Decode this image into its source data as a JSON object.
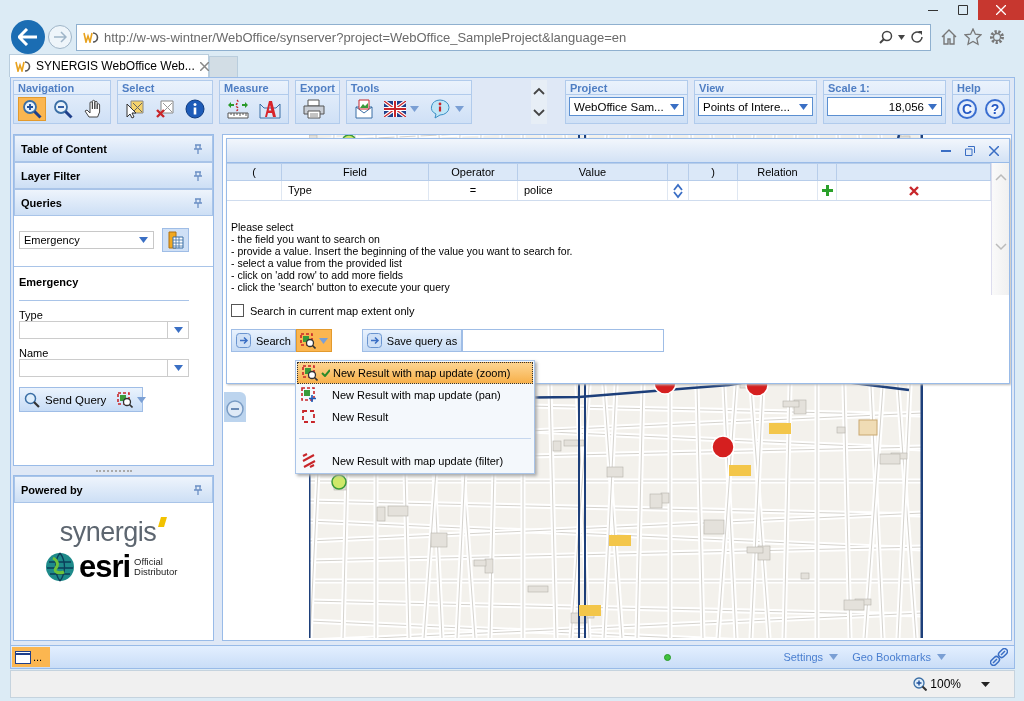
{
  "browser": {
    "url": "http://w-ws-wintner/WebOffice/synserver?project=WebOffice_SampleProject&language=en",
    "tabs": [
      {
        "title": "SYNERGIS WebOffice Web...",
        "selected": true
      }
    ]
  },
  "toolbar": {
    "groups": [
      {
        "title": "Navigation",
        "tools": [
          {
            "kind": "zoom-in",
            "selected": true
          },
          {
            "kind": "zoom-out",
            "selected": false
          },
          {
            "kind": "pan",
            "selected": false
          }
        ]
      },
      {
        "title": "Select",
        "tools": [
          {
            "kind": "select",
            "selected": false
          },
          {
            "kind": "clear-selection",
            "selected": false
          },
          {
            "kind": "info",
            "selected": false
          }
        ]
      },
      {
        "title": "Measure",
        "tools": [
          {
            "kind": "measure",
            "selected": false
          },
          {
            "kind": "annotate",
            "selected": false
          }
        ]
      },
      {
        "title": "Export",
        "tools": [
          {
            "kind": "print",
            "selected": false
          }
        ]
      },
      {
        "title": "Tools",
        "tools": [
          {
            "kind": "map-image",
            "selected": false
          },
          {
            "kind": "flag",
            "selected": false,
            "dropdown": true
          },
          {
            "kind": "tooltip",
            "selected": false,
            "dropdown": true
          }
        ]
      }
    ],
    "selectors": [
      {
        "title": "Project",
        "value": "WebOffice Sam...",
        "kind": "text"
      },
      {
        "title": "View",
        "value": "Points of Intere...",
        "kind": "text"
      },
      {
        "title": "Scale 1:",
        "value": "18,056",
        "kind": "number"
      }
    ],
    "help": {
      "title": "Help",
      "buttons": [
        "C",
        "?"
      ]
    }
  },
  "sidebar": {
    "panels": [
      {
        "title": "Table of Content",
        "expanded": false
      },
      {
        "title": "Layer Filter",
        "expanded": false
      },
      {
        "title": "Queries",
        "expanded": true
      }
    ],
    "query_select": "Emergency",
    "query_title": "Emergency",
    "fields": [
      {
        "label": "Type"
      },
      {
        "label": "Name"
      }
    ],
    "send_button": "Send Query",
    "powered_by": {
      "title": "Powered by",
      "synergis": "synergis",
      "esri": "esri",
      "esri_note": "Official Distributor"
    }
  },
  "query_window": {
    "columns": [
      {
        "kind": "open",
        "label": "("
      },
      {
        "kind": "field",
        "label": "Field"
      },
      {
        "kind": "operator",
        "label": "Operator"
      },
      {
        "kind": "value",
        "label": "Value"
      },
      {
        "kind": "spin"
      },
      {
        "kind": "close",
        "label": ")"
      },
      {
        "kind": "relation",
        "label": "Relation"
      },
      {
        "kind": "add"
      },
      {
        "kind": "remove"
      }
    ],
    "rows": [
      {
        "field": "Type",
        "operator": "=",
        "value": "police"
      }
    ],
    "instructions": [
      "Please select",
      "- the field you want to search on",
      "- provide a value. Insert the beginning of the value you want to search for.",
      "- select a value from the provided list",
      "- click on 'add row' to add more fields",
      "- click the 'search' button to execute your query"
    ],
    "extent_checkbox": {
      "label": "Search in current map extent only",
      "checked": false
    },
    "search_button": "Search",
    "save_button": "Save query as",
    "result_menu": [
      {
        "kind": "zoom",
        "label": "New Result with map update (zoom)",
        "selected": true,
        "divider_before": false
      },
      {
        "kind": "pan",
        "label": "New Result with map update (pan)",
        "selected": false,
        "divider_before": false
      },
      {
        "kind": "new",
        "label": "New Result",
        "selected": false,
        "divider_before": false
      },
      {
        "kind": "filter",
        "label": "New Result with map update (filter)",
        "selected": false,
        "divider_before": true
      }
    ]
  },
  "status_bar": {
    "window_button": "...",
    "connected": true,
    "links": [
      "Settings",
      "Geo Bookmarks"
    ]
  },
  "browser_status": {
    "zoom": "100%"
  }
}
